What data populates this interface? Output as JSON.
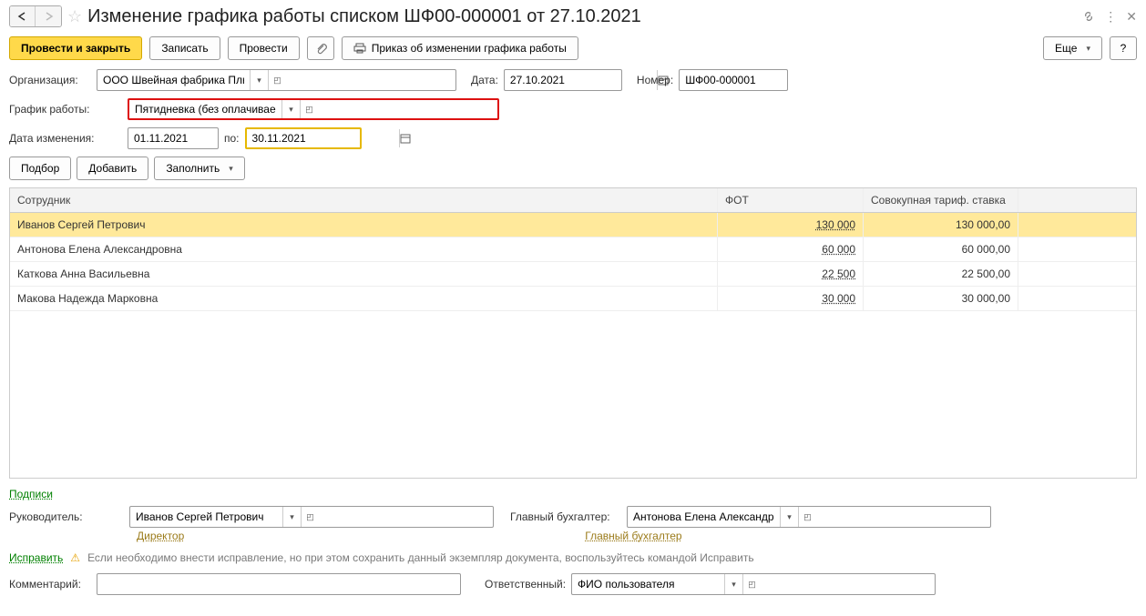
{
  "title": "Изменение графика работы списком ШФ00-000001 от 27.10.2021",
  "toolbar": {
    "post_close": "Провести и закрыть",
    "save": "Записать",
    "post": "Провести",
    "order": "Приказ об изменении графика работы",
    "more": "Еще"
  },
  "fields": {
    "org_label": "Организация:",
    "org_value": "ООО Швейная фабрика Плюс",
    "date_label": "Дата:",
    "date_value": "27.10.2021",
    "number_label": "Номер:",
    "number_value": "ШФ00-000001",
    "schedule_label": "График работы:",
    "schedule_value": "Пятидневка (без оплачиваемых нерабочих дней)",
    "change_date_label": "Дата изменения:",
    "change_date_value": "01.11.2021",
    "to_label": "по:",
    "to_value": "30.11.2021"
  },
  "table_toolbar": {
    "pick": "Подбор",
    "add": "Добавить",
    "fill": "Заполнить"
  },
  "table": {
    "headers": {
      "employee": "Сотрудник",
      "fot": "ФОТ",
      "rate": "Совокупная тариф. ставка"
    },
    "rows": [
      {
        "employee": "Иванов Сергей Петрович",
        "fot": "130 000",
        "rate": "130 000,00",
        "selected": true
      },
      {
        "employee": "Антонова Елена Александровна",
        "fot": "60 000",
        "rate": "60 000,00",
        "selected": false
      },
      {
        "employee": "Каткова Анна Васильевна",
        "fot": "22 500",
        "rate": "22 500,00",
        "selected": false
      },
      {
        "employee": "Макова Надежда Марковна",
        "fot": "30 000",
        "rate": "30 000,00",
        "selected": false
      }
    ]
  },
  "signatures": {
    "link": "Подписи",
    "manager_label": "Руководитель:",
    "manager_value": "Иванов Сергей Петрович",
    "manager_role": "Директор",
    "chief_acc_label": "Главный бухгалтер:",
    "chief_acc_value": "Антонова Елена Александровна",
    "chief_acc_role": "Главный бухгалтер"
  },
  "correction": {
    "link": "Исправить",
    "text": "Если необходимо внести исправление, но при этом сохранить данный экземпляр документа, воспользуйтесь командой Исправить"
  },
  "footer": {
    "comment_label": "Комментарий:",
    "responsible_label": "Ответственный:",
    "responsible_value": "ФИО пользователя"
  }
}
